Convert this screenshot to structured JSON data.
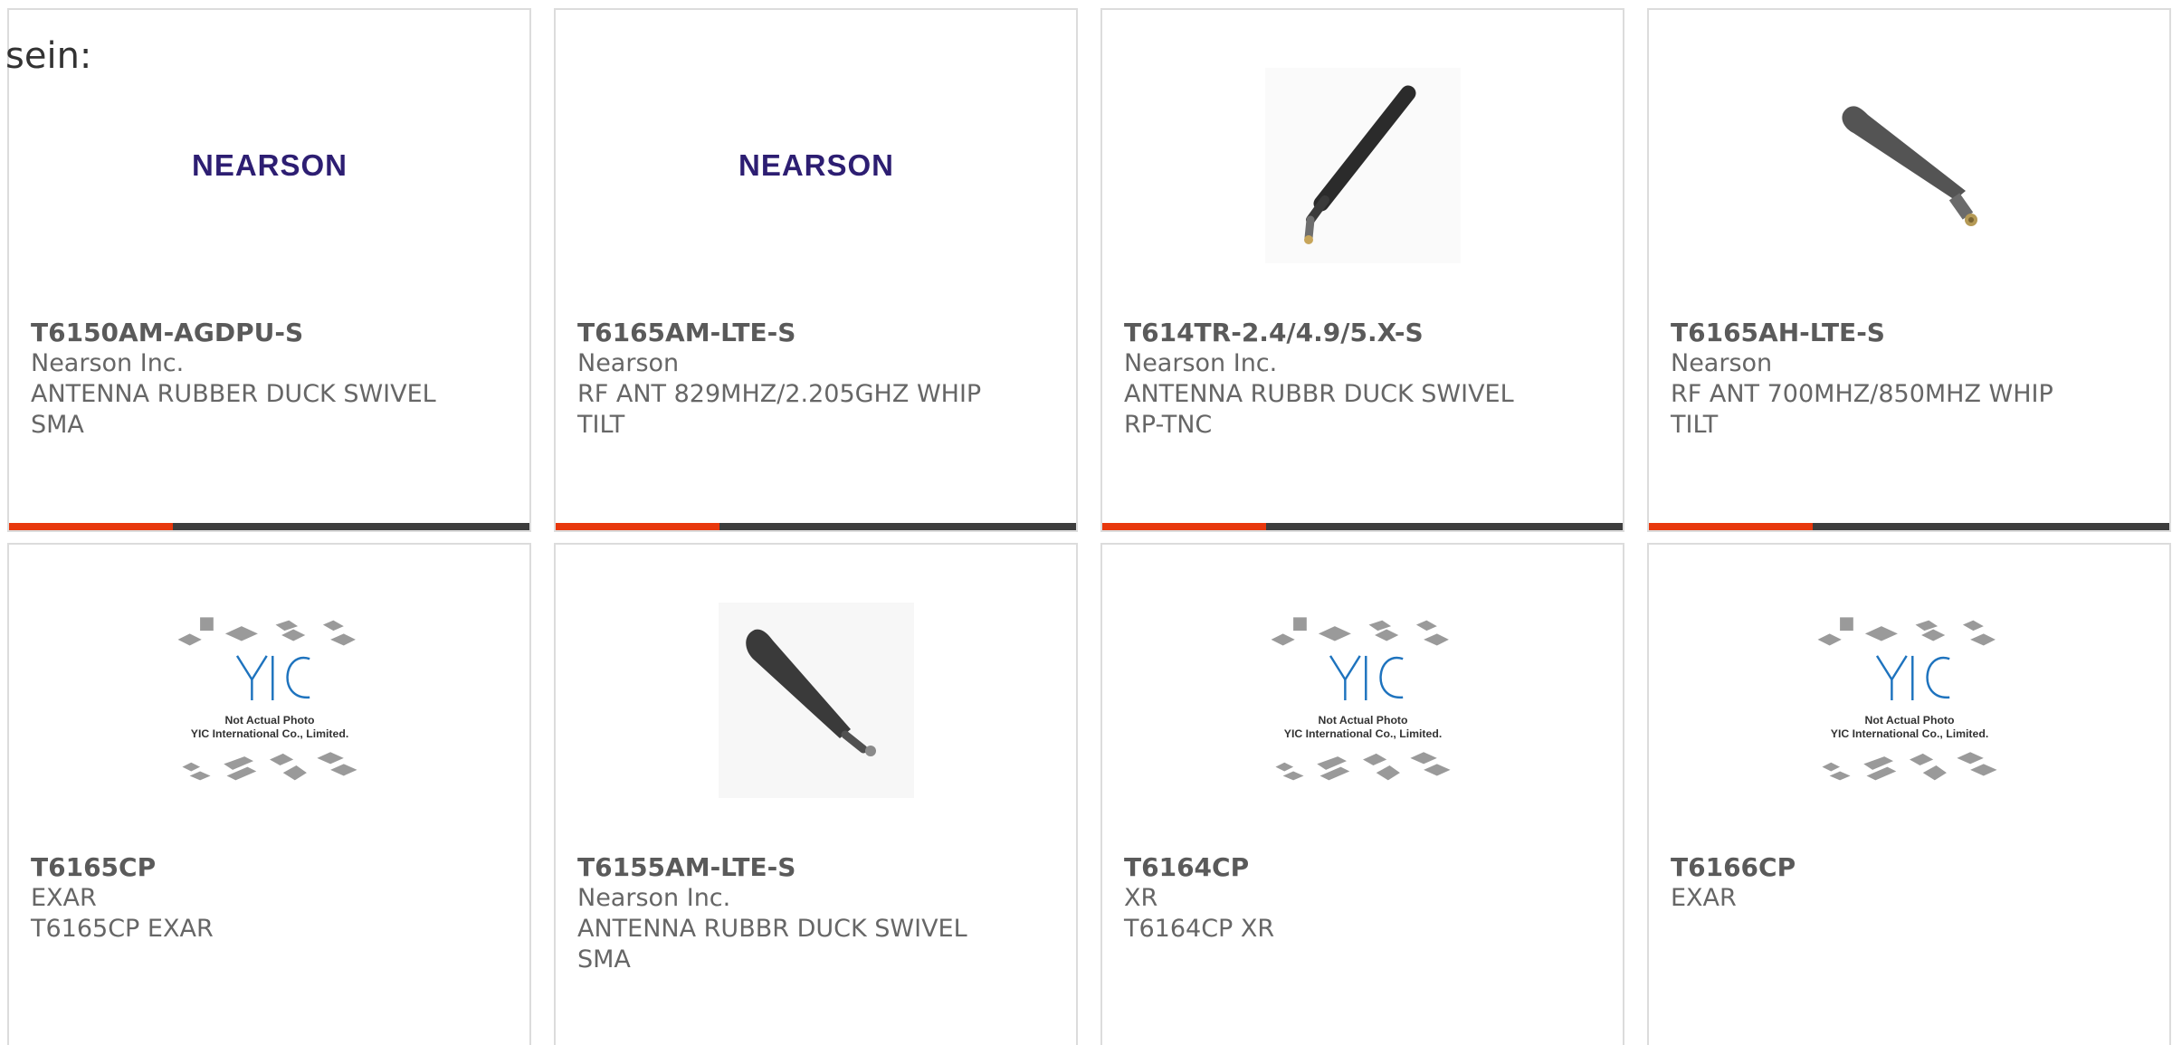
{
  "page": {
    "heading": "sein:"
  },
  "colors": {
    "accent_red": "#e8380d",
    "accent_dark": "#3d3d3d",
    "card_border": "#dcdcdc",
    "nearson_logo": "#2d1e72",
    "yic_logo": "#1e73be"
  },
  "products": [
    {
      "part": "T6150AM-AGDPU-S",
      "manufacturer": "Nearson Inc.",
      "description": "ANTENNA RUBBER DUCK SWIVEL SMA",
      "image": "nearson-logo",
      "logo_text": "NEARSON"
    },
    {
      "part": "T6165AM-LTE-S",
      "manufacturer": "Nearson",
      "description": "RF ANT 829MHZ/2.205GHZ WHIP TILT",
      "image": "nearson-logo",
      "logo_text": "NEARSON"
    },
    {
      "part": "T614TR-2.4/4.9/5.X-S",
      "manufacturer": "Nearson Inc.",
      "description": "ANTENNA RUBBR DUCK SWIVEL RP-TNC",
      "image": "antenna-thin-photo"
    },
    {
      "part": "T6165AH-LTE-S",
      "manufacturer": "Nearson",
      "description": "RF ANT 700MHZ/850MHZ WHIP TILT",
      "image": "antenna-paddle-photo"
    },
    {
      "part": "T6165CP",
      "manufacturer": "EXAR",
      "description": "T6165CP EXAR",
      "image": "not-actual-photo-placeholder",
      "placeholder_line1": "Not Actual Photo",
      "placeholder_line2": "YIC International Co., Limited."
    },
    {
      "part": "T6155AM-LTE-S",
      "manufacturer": "Nearson Inc.",
      "description": "ANTENNA RUBBR DUCK SWIVEL SMA",
      "image": "antenna-dark-photo"
    },
    {
      "part": "T6164CP",
      "manufacturer": "XR",
      "description": "T6164CP XR",
      "image": "not-actual-photo-placeholder",
      "placeholder_line1": "Not Actual Photo",
      "placeholder_line2": "YIC International Co., Limited."
    },
    {
      "part": "T6166CP",
      "manufacturer": "EXAR",
      "description": "",
      "image": "not-actual-photo-placeholder",
      "placeholder_line1": "Not Actual Photo",
      "placeholder_line2": "YIC International Co., Limited."
    }
  ]
}
